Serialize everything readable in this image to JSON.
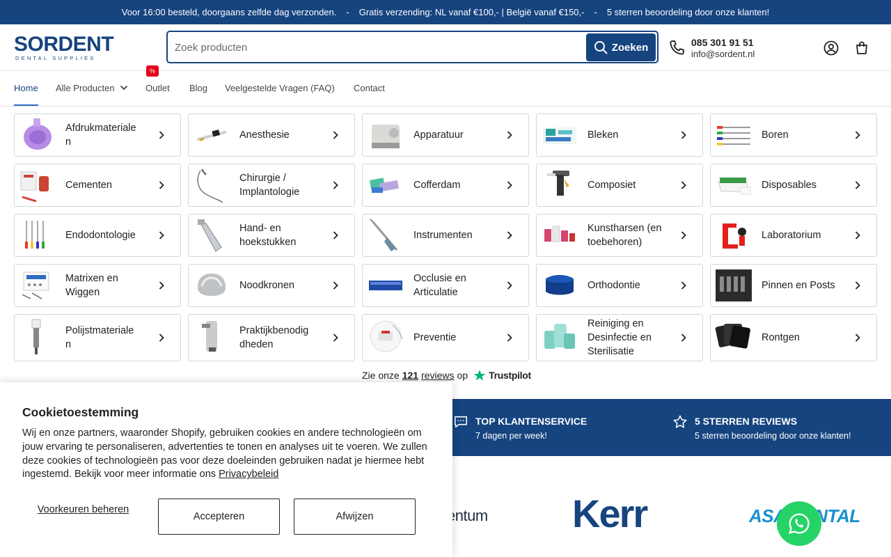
{
  "topbar": {
    "msg1": "Voor 16:00 besteld, doorgaans zelfde dag verzonden.",
    "msg2": "Gratis verzending: NL vanaf €100,- | België vanaf €150,-",
    "msg3": "5 sterren beoordeling door onze klanten!",
    "sep": "-"
  },
  "header": {
    "logo_word": "SORDENT",
    "logo_sub": "DENTAL SUPPLIES",
    "search_placeholder": "Zoek producten",
    "search_button": "Zoeken",
    "phone": "085 301 91 51",
    "email": "info@sordent.nl",
    "icons": [
      "phone-icon",
      "search-icon",
      "account-icon",
      "cart-icon"
    ]
  },
  "nav": {
    "items": [
      "Home",
      "Alle Producten",
      "Outlet",
      "Blog",
      "Veelgestelde Vragen (FAQ)",
      "Contact"
    ],
    "outlet_badge": "%"
  },
  "categories": [
    "Afdrukmateriale\nn",
    "Anesthesie",
    "Apparatuur",
    "Bleken",
    "Boren",
    "Cementen",
    "Chirurgie /\nImplantologie",
    "Cofferdam",
    "Composiet",
    "Disposables",
    "Endodontologie",
    "Hand- en\nhoekstukken",
    "Instrumenten",
    "Kunstharsen (en\ntoebehoren)",
    "Laboratorium",
    "Matrixen en\nWiggen",
    "Noodkronen",
    "Occlusie en\nArticulatie",
    "Orthodontie",
    "Pinnen en Posts",
    "Polijstmateriale\nn",
    "Praktijkbenodig\ndheden",
    "Preventie",
    "Reiniging en\nDesinfectie en\nSterilisatie",
    "Rontgen"
  ],
  "trustpilot": {
    "pre": "Zie onze",
    "count": "121",
    "reviews": "reviews",
    "op": "op",
    "brand": "Trustpilot"
  },
  "features": [
    {
      "title": "TOP KLANTENSERVICE",
      "sub": "7 dagen per week!",
      "icon": "chat-icon"
    },
    {
      "title": "5 STERREN REVIEWS",
      "sub": "5 sterren beoordeling door onze klanten!",
      "icon": "star-icon"
    }
  ],
  "brands": [
    "entum",
    "Kerr",
    "ASA DENTAL"
  ],
  "cookie": {
    "title": "Cookietoestemming",
    "text": "Wij en onze partners, waaronder Shopify, gebruiken cookies en andere technologieën om jouw ervaring te personaliseren, advertenties te tonen en analyses uit te voeren. We zullen deze cookies of technologieën pas voor deze doeleinden gebruiken nadat je hiermee hebt ingestemd. Bekijk voor meer informatie ons",
    "link": "Privacybeleid",
    "manage": "Voorkeuren beheren",
    "accept": "Accepteren",
    "reject": "Afwijzen"
  },
  "colors": {
    "brand": "#16447f",
    "badge": "#e3001b",
    "whatsapp": "#25d366",
    "trustpilot": "#00b67a"
  }
}
